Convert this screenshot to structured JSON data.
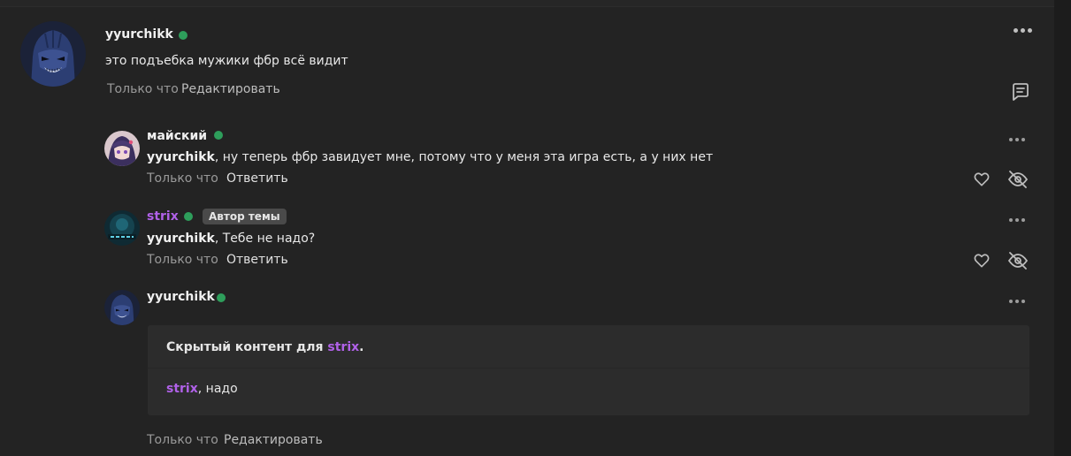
{
  "colors": {
    "background": "#232323",
    "online": "#2e9e5b",
    "author_accent": "#b061e8",
    "badge_bg": "#4a4a4a"
  },
  "main_post": {
    "author": "yyurchikk",
    "text": "это подъебка мужики фбр всё видит",
    "time": "Только что",
    "edit_label": "Редактировать",
    "reply_icon": "comment-icon",
    "more_icon": "more-horizontal-icon"
  },
  "replies": [
    {
      "author": "майский",
      "mention": "yyurchikk",
      "text": ", ну теперь фбр завидует мне, потому что у меня эта игра есть, а у них нет",
      "time": "Только что",
      "action": "Ответить",
      "like_icon": "heart-icon",
      "hide_icon": "eye-off-icon"
    },
    {
      "author": "strix",
      "badge": "Автор темы",
      "mention": "yyurchikk",
      "text": ", Тебе не надо?",
      "time": "Только что",
      "action": "Ответить",
      "like_icon": "heart-icon",
      "hide_icon": "eye-off-icon"
    },
    {
      "author": "yyurchikk",
      "hidden_prefix": "Скрытый контент для ",
      "hidden_target": "strix",
      "hidden_suffix": ".",
      "hidden_mention": "strix",
      "hidden_text": ", надо",
      "time": "Только что",
      "action": "Редактировать"
    }
  ]
}
